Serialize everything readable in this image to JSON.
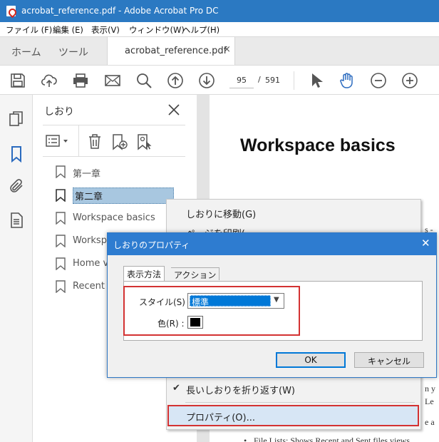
{
  "window": {
    "title": "acrobat_reference.pdf - Adobe Acrobat Pro DC"
  },
  "menu": [
    "ファイル (F)",
    "編集 (E)",
    "表示(V)",
    "ウィンドウ(W)",
    "ヘルプ(H)"
  ],
  "tabs": {
    "home": "ホーム",
    "tools": "ツール",
    "document": "acrobat_reference.pdf",
    "close": "×"
  },
  "toolbar": {
    "current_page": "95",
    "separator": "/",
    "total_pages": "591"
  },
  "bookmarks_panel": {
    "title": "しおり",
    "items": [
      "第一章",
      "第二章",
      "Workspace basics",
      "Workspa",
      "Home v",
      "Recent f"
    ],
    "selected_index": 1
  },
  "document": {
    "heading": "Workspace basics",
    "fragments": [
      "s -",
      "n y",
      "Le",
      "e a",
      "File Lists: Shows Recent and Sent files views"
    ]
  },
  "context_menu": {
    "items": [
      "しおりに移動(G)",
      "ページを印刷(",
      "長いしおりを折り返す(W)",
      "プロパティ(O)..."
    ],
    "wrap_checked": true,
    "highlighted": "プロパティ(O)..."
  },
  "dialog": {
    "title": "しおりのプロパティ",
    "close": "✕",
    "tabs": [
      "表示方法",
      "アクション"
    ],
    "style_label": "スタイル(S) :",
    "style_value": "標準",
    "color_label": "色(R) :",
    "color_value": "#000000",
    "ok": "OK",
    "cancel": "キャンセル"
  },
  "colors": {
    "titlebar": "#2b79c2",
    "accent": "#0078d7",
    "highlight_border": "#d33232",
    "icon_blue": "#2b6bbf"
  }
}
